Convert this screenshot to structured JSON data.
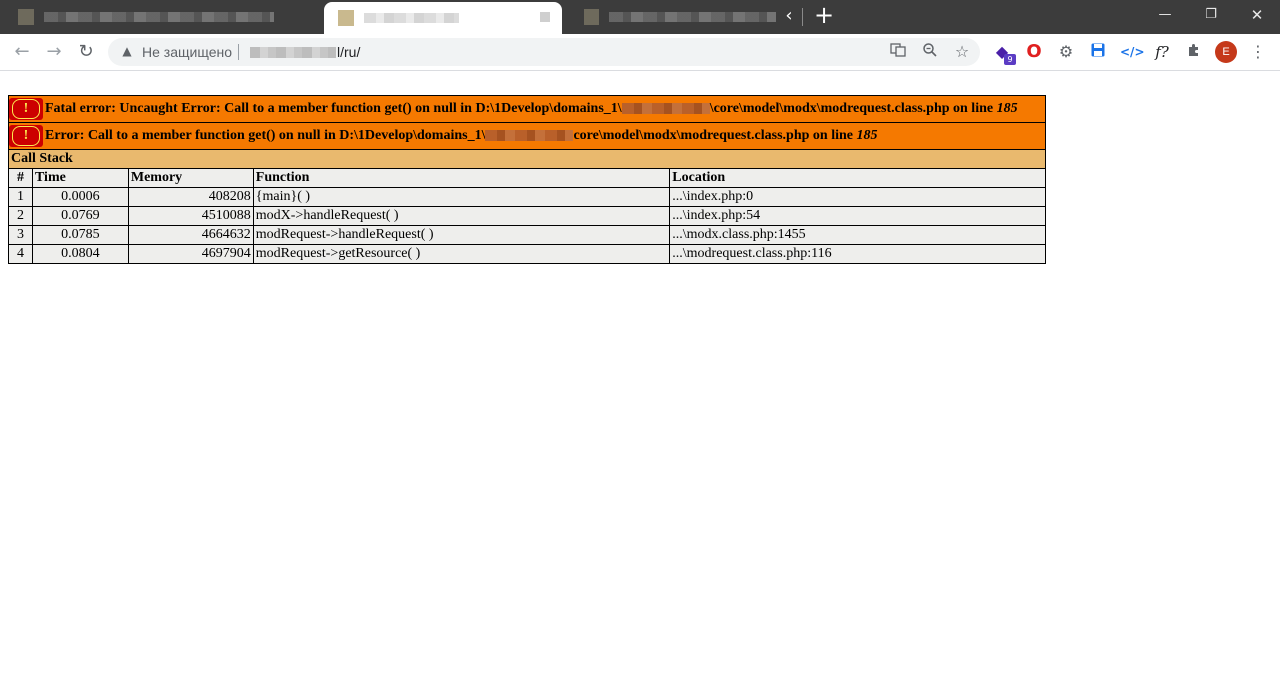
{
  "browser": {
    "tab_scroll_label": "‹",
    "new_tab_label": "+",
    "window_controls": {
      "minimize": "—",
      "maximize": "❐",
      "close": "✕"
    },
    "nav": {
      "back": "←",
      "forward": "→",
      "reload": "↻"
    },
    "address_bar": {
      "security_label": "Не защищено",
      "url_path": "l/ru/"
    },
    "extensions": {
      "badge_count": "9",
      "profile_initial": "E",
      "formula_label": "f?"
    }
  },
  "error_page": {
    "fatal_error": {
      "icon_text": "!",
      "prefix": "Fatal error: Uncaught Error: Call to a member function get() on null in D:\\1Develop\\domains_1\\",
      "suffix": "\\core\\model\\modx\\modrequest.class.php on line ",
      "line": "185"
    },
    "error": {
      "icon_text": "!",
      "prefix": "Error: Call to a member function get() on null in D:\\1Develop\\domains_1\\",
      "suffix": "core\\model\\modx\\modrequest.class.php on line ",
      "line": "185"
    },
    "call_stack": {
      "title": "Call Stack",
      "columns": {
        "num": "#",
        "time": "Time",
        "memory": "Memory",
        "function": "Function",
        "location": "Location"
      },
      "rows": [
        {
          "num": "1",
          "time": "0.0006",
          "memory": "408208",
          "function": "{main}( )",
          "location": "...\\index.php:0"
        },
        {
          "num": "2",
          "time": "0.0769",
          "memory": "4510088",
          "function": "modX->handleRequest( )",
          "location": "...\\index.php:54"
        },
        {
          "num": "3",
          "time": "0.0785",
          "memory": "4664632",
          "function": "modRequest->handleRequest( )",
          "location": "...\\modx.class.php:1455"
        },
        {
          "num": "4",
          "time": "0.0804",
          "memory": "4697904",
          "function": "modRequest->getResource( )",
          "location": "...\\modrequest.class.php:116"
        }
      ]
    }
  },
  "colors": {
    "error_bg": "#f57900",
    "callstack_bg": "#e9b96e",
    "row_bg": "#eeeeec",
    "tabstrip_bg": "#3c3c3c"
  }
}
